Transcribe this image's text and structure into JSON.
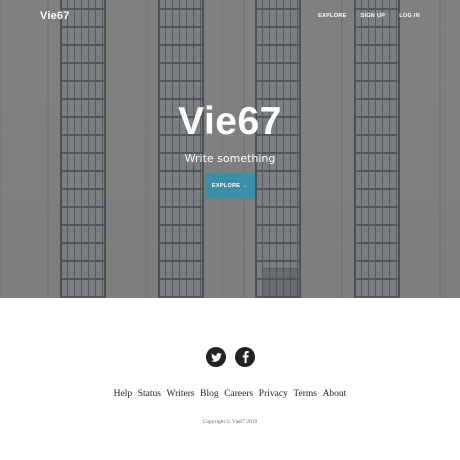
{
  "header": {
    "brand": "Vie67",
    "nav": [
      {
        "label": "EXPLORE"
      },
      {
        "label": "SIGN UP"
      },
      {
        "label": "LOG IN"
      }
    ]
  },
  "hero": {
    "title": "Vie67",
    "subtitle": "Write something",
    "button_label": "EXPLORE",
    "button_arrow": "→",
    "button_color": "#3d8ca8"
  },
  "footer": {
    "social": [
      {
        "icon": "twitter-icon"
      },
      {
        "icon": "facebook-icon"
      }
    ],
    "links": [
      "Help",
      "Status",
      "Writers",
      "Blog",
      "Careers",
      "Privacy",
      "Terms",
      "About"
    ],
    "copyright": "Copyright © Vie67 2019"
  }
}
